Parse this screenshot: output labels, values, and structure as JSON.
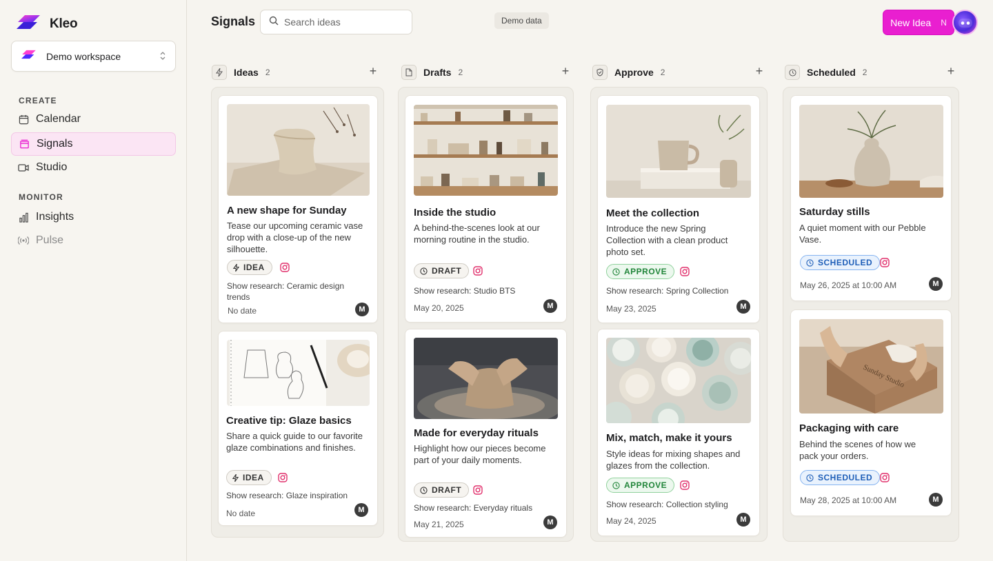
{
  "brand": {
    "name": "Kleo"
  },
  "workspace": {
    "label": "Demo workspace"
  },
  "sidebar": {
    "create_label": "CREATE",
    "monitor_label": "MONITOR",
    "items": [
      {
        "label": "Calendar",
        "icon": "calendar-icon"
      },
      {
        "label": "Signals",
        "icon": "folder-icon",
        "active": true
      },
      {
        "label": "Studio",
        "icon": "video-icon"
      },
      {
        "label": "Insights",
        "icon": "bar-chart-icon"
      },
      {
        "label": "Pulse",
        "icon": "broadcast-icon"
      }
    ]
  },
  "header": {
    "title": "Signals",
    "search_placeholder": "Search ideas",
    "demo_badge": "Demo data",
    "new_idea_label": "New Idea",
    "new_idea_shortcut": "N"
  },
  "columns": [
    {
      "title": "Ideas",
      "count": "2",
      "icon": "bolt-icon"
    },
    {
      "title": "Drafts",
      "count": "2",
      "icon": "document-icon"
    },
    {
      "title": "Approve",
      "count": "2",
      "icon": "shield-check-icon"
    },
    {
      "title": "Scheduled",
      "count": "2",
      "icon": "clock-icon"
    }
  ],
  "cards": [
    {
      "title": "A new shape for Sunday",
      "desc": "Tease our upcoming ceramic vase drop with a close-up of the new silhouette.",
      "status": "IDEA",
      "research": "Show research: Ceramic design trends",
      "date": "No date",
      "avatar": "M"
    },
    {
      "title": "Creative tip: Glaze basics",
      "desc": "Share a quick guide to our favorite glaze combinations and finishes.",
      "status": "IDEA",
      "research": "Show research: Glaze inspiration",
      "date": "No date",
      "avatar": "M"
    },
    {
      "title": "Inside the studio",
      "desc": "A behind-the-scenes look at our morning routine in the studio.",
      "status": "DRAFT",
      "research": "Show research: Studio BTS",
      "date": "May 20, 2025",
      "avatar": "M"
    },
    {
      "title": "Made for everyday rituals",
      "desc": "Highlight how our pieces become part of your daily moments.",
      "status": "DRAFT",
      "research": "Show research: Everyday rituals",
      "date": "May 21, 2025",
      "avatar": "M"
    },
    {
      "title": "Meet the collection",
      "desc": "Introduce the new Spring Collection with a clean product photo set.",
      "status": "APPROVE",
      "research": "Show research: Spring Collection",
      "date": "May 23, 2025",
      "avatar": "M"
    },
    {
      "title": "Mix, match, make it yours",
      "desc": "Style ideas for mixing shapes and glazes from the collection.",
      "status": "APPROVE",
      "research": "Show research: Collection styling",
      "date": "May 24, 2025",
      "avatar": "M"
    },
    {
      "title": "Saturday stills",
      "desc": "A quiet moment with our Pebble Vase.",
      "status": "SCHEDULED",
      "date": "May 26, 2025 at 10:00 AM",
      "avatar": "M"
    },
    {
      "title": "Packaging with care",
      "desc": "Behind the scenes of how we pack your orders.",
      "status": "SCHEDULED",
      "date": "May 28, 2025 at 10:00 AM",
      "avatar": "M",
      "box_text": "Sunday Studio"
    }
  ],
  "colors": {
    "accent": "#e91fd0",
    "approve": "#21853a",
    "scheduled": "#1f5fb8",
    "instagram": "#e1306c"
  }
}
